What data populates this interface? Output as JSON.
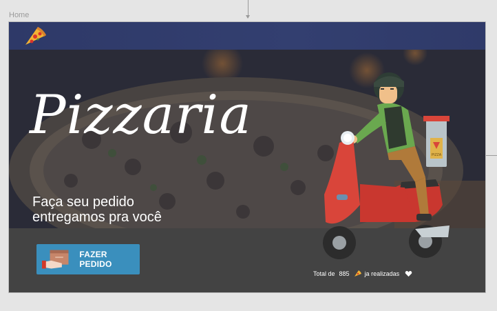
{
  "canvas": {
    "frame_label": "Home"
  },
  "header": {
    "logo_icon": "pizza-slice-icon"
  },
  "hero": {
    "title": "Pizzaria",
    "subtitle_line1": "Faça seu pedido",
    "subtitle_line2": "entregamos pra você",
    "illustration_box_label": "PIZZA"
  },
  "actions": {
    "order_button_label": "FAZER PEDIDO",
    "order_button_icon": "delivery-box-hand-icon"
  },
  "footer": {
    "prefix": "Total de",
    "count": "885",
    "suffix": "ja realizadas",
    "pizza_icon": "pizza-slice-icon",
    "heart_icon": "heart-icon"
  },
  "colors": {
    "header": "#2e3968",
    "button": "#3a8fbd",
    "panel": "#434343"
  }
}
